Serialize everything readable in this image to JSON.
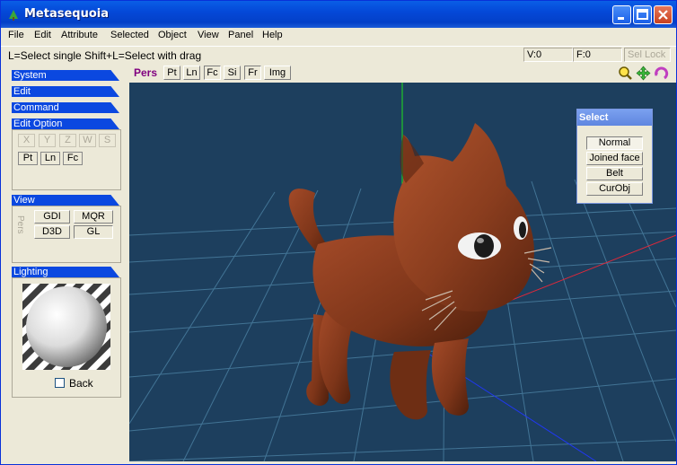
{
  "window": {
    "title": "Metasequoia"
  },
  "menu": [
    "File",
    "Edit",
    "Attribute",
    "Selected",
    "Object",
    "View",
    "Panel",
    "Help"
  ],
  "status": {
    "hint": "L=Select single  Shift+L=Select with drag",
    "vertices": "V:0",
    "faces": "F:0",
    "sel_lock": "Sel Lock"
  },
  "sidebar": {
    "system": "System",
    "edit": "Edit",
    "command": "Command",
    "edit_option": "Edit Option",
    "axis_buttons": [
      "X",
      "Y",
      "Z",
      "W",
      "S"
    ],
    "mode_buttons": [
      "Pt",
      "Ln",
      "Fc"
    ],
    "view": "View",
    "view_side_label": "Pers",
    "renderers": [
      "GDI",
      "MQR",
      "D3D",
      "GL"
    ],
    "lighting": "Lighting",
    "back_label": "Back"
  },
  "viewport_toolbar": {
    "pers": "Pers",
    "buttons": [
      "Pt",
      "Ln",
      "Fc",
      "Si",
      "Fr",
      "Img"
    ]
  },
  "select_panel": {
    "title": "Select",
    "buttons": [
      "Normal",
      "Joined face",
      "Belt",
      "CurObj"
    ]
  },
  "colors": {
    "title_blue": "#0448d8",
    "viewport_bg": "#1d3f5e",
    "cat_brown": "#8a3d22",
    "grid": "#4a7fa0"
  },
  "icons": [
    "app-icon",
    "minimize-icon",
    "maximize-icon",
    "close-icon",
    "zoom-icon",
    "move-icon",
    "rotate-icon"
  ]
}
